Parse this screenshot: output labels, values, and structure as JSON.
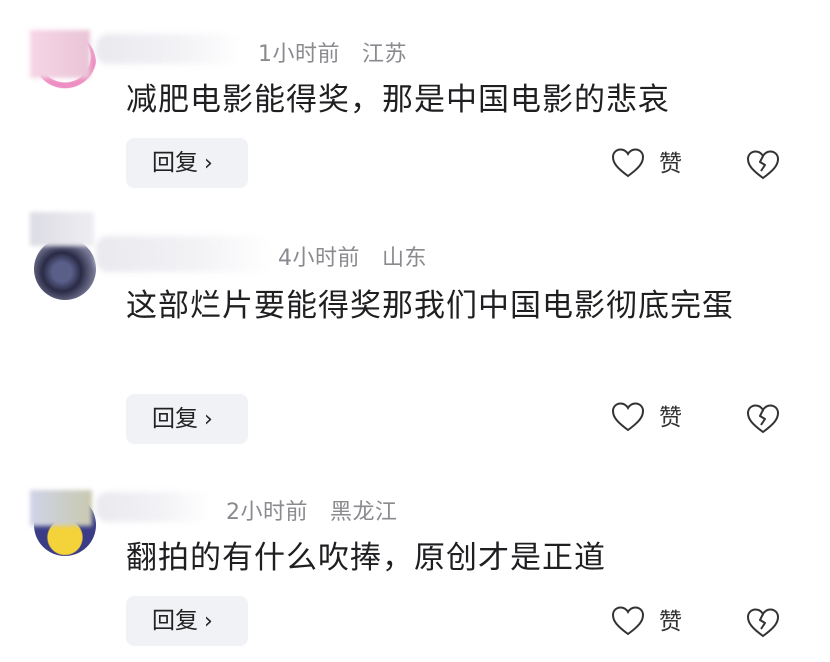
{
  "comments": [
    {
      "time": "1小时前",
      "location": "江苏",
      "text": "减肥电影能得奖，那是中国电影的悲哀",
      "reply_label": "回复",
      "like_label": "赞"
    },
    {
      "time": "4小时前",
      "location": "山东",
      "text": "这部烂片要能得奖那我们中国电影彻底完蛋",
      "reply_label": "回复",
      "like_label": "赞"
    },
    {
      "time": "2小时前",
      "location": "黑龙江",
      "text": "翻拍的有什么吹捧，原创才是正道",
      "reply_label": "回复",
      "like_label": "赞"
    }
  ],
  "icons": {
    "reply_chevron": "chevron-right-icon",
    "like": "heart-outline-icon",
    "dislike": "broken-heart-icon"
  },
  "colors": {
    "meta_text": "#8a8a8f",
    "body_text": "#1f1f22",
    "reply_bg": "#f1f2f5"
  }
}
